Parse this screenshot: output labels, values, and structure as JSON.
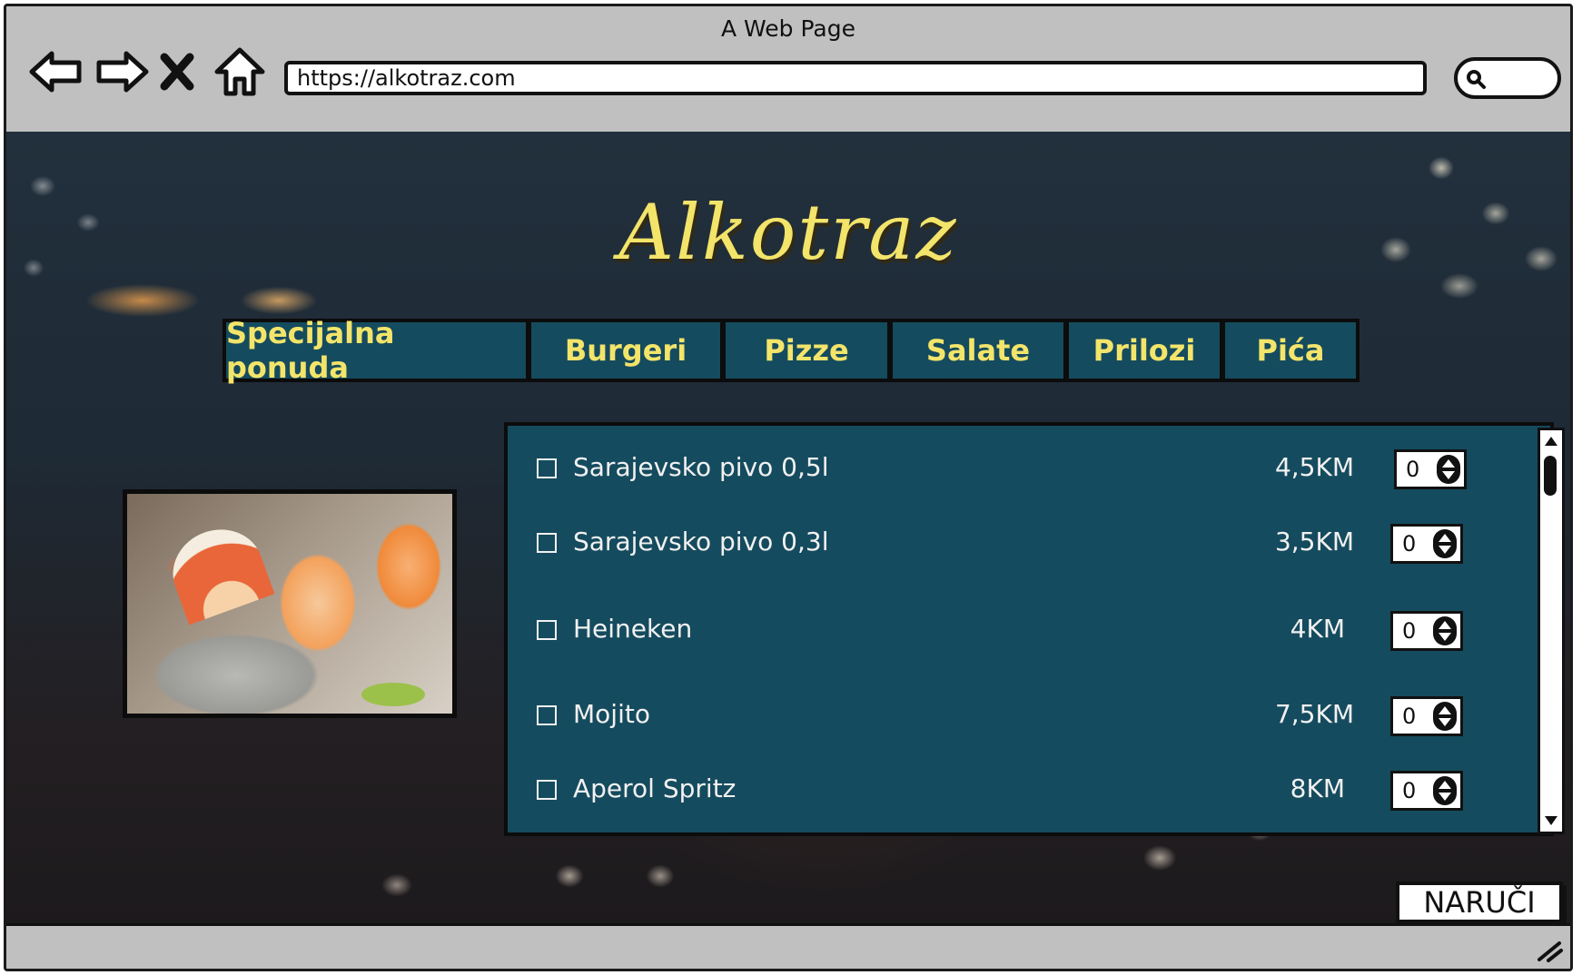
{
  "window": {
    "title": "A Web Page"
  },
  "browser": {
    "url": "https://alkotraz.com"
  },
  "brand": {
    "name": "Alkotraz"
  },
  "tabs": [
    "Specijalna ponuda",
    "Burgeri",
    "Pizze",
    "Salate",
    "Prilozi",
    "Pića"
  ],
  "menu": {
    "items": [
      {
        "name": "Sarajevsko pivo 0,5l",
        "price": "4,5KM",
        "quantity": "0",
        "checked": false
      },
      {
        "name": "Sarajevsko pivo 0,3l",
        "price": "3,5KM",
        "quantity": "0",
        "checked": false
      },
      {
        "name": "Heineken",
        "price": "4KM",
        "quantity": "0",
        "checked": false
      },
      {
        "name": "Mojito",
        "price": "7,5KM",
        "quantity": "0",
        "checked": false
      },
      {
        "name": "Aperol Spritz",
        "price": "8KM",
        "quantity": "0",
        "checked": false
      }
    ]
  },
  "actions": {
    "order_label": "NARUČI"
  },
  "colors": {
    "panel": "#154b5e",
    "accent_text": "#f3e46a",
    "chrome": "#c0c0c0"
  },
  "icons": [
    "back-arrow-icon",
    "forward-arrow-icon",
    "close-icon",
    "home-icon",
    "search-icon",
    "spinner-arrows-icon",
    "resize-grip-icon"
  ]
}
